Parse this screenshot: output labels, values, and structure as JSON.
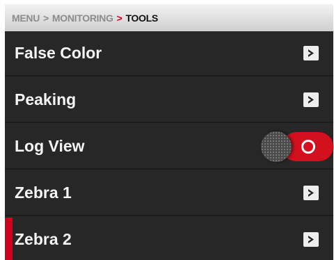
{
  "breadcrumb": {
    "items": [
      "MENU",
      "MONITORING",
      "TOOLS"
    ],
    "separator": ">"
  },
  "menu": {
    "items": [
      {
        "label": "False Color",
        "control": "chevron-right-icon"
      },
      {
        "label": "Peaking",
        "control": "chevron-right-icon"
      },
      {
        "label": "Log View",
        "control": "toggle",
        "toggle_on": true
      },
      {
        "label": "Zebra 1",
        "control": "chevron-right-icon"
      },
      {
        "label": "Zebra 2",
        "control": "chevron-right-icon",
        "selected": true
      }
    ]
  },
  "colors": {
    "accent": "#d0021b",
    "background": "#272727",
    "text": "#f5f5f5"
  }
}
